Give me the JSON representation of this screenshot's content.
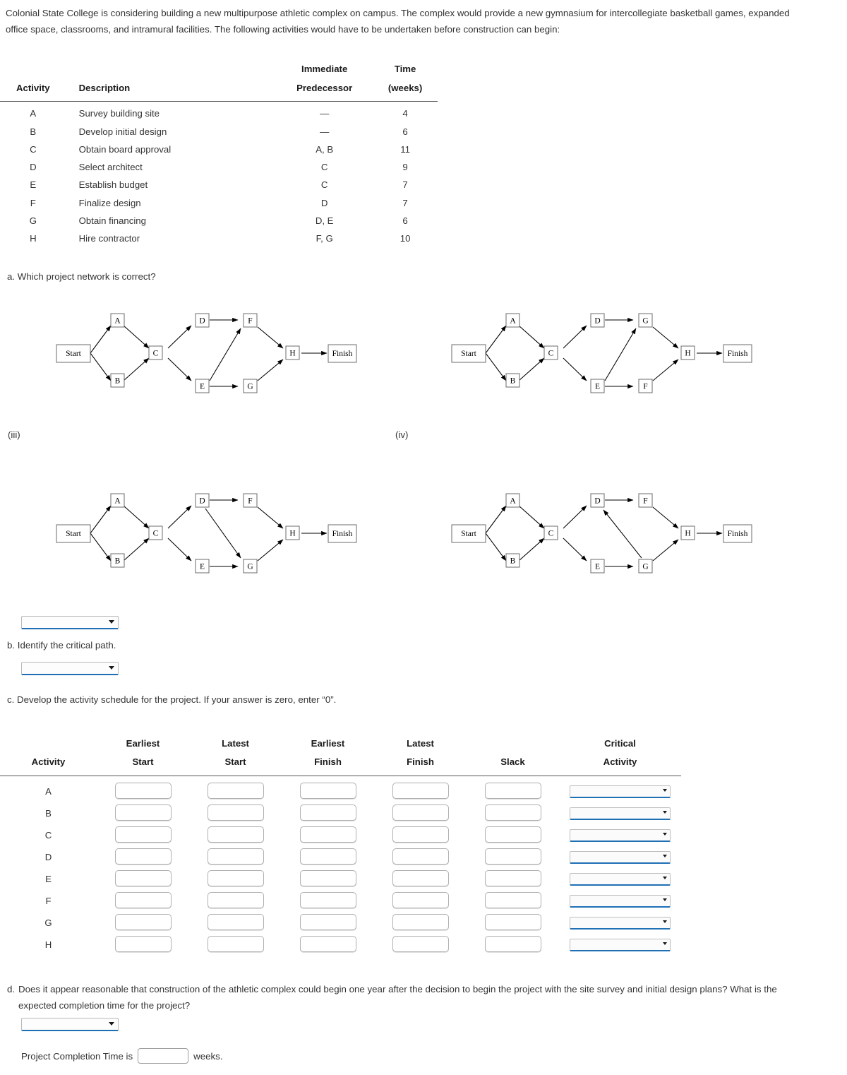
{
  "intro": "Colonial State College is considering building a new multipurpose athletic complex on campus. The complex would provide a new gymnasium for intercollegiate basketball games, expanded office space, classrooms, and intramural facilities. The following activities would have to be undertaken before construction can begin:",
  "activity_table": {
    "headers": {
      "activity": "Activity",
      "description": "Description",
      "predecessor_line1": "Immediate",
      "predecessor_line2": "Predecessor",
      "time_line1": "Time",
      "time_line2": "(weeks)"
    },
    "rows": [
      {
        "activity": "A",
        "description": "Survey building site",
        "predecessor": "—",
        "time": "4"
      },
      {
        "activity": "B",
        "description": "Develop initial design",
        "predecessor": "—",
        "time": "6"
      },
      {
        "activity": "C",
        "description": "Obtain board approval",
        "predecessor": "A, B",
        "time": "11"
      },
      {
        "activity": "D",
        "description": "Select architect",
        "predecessor": "C",
        "time": "9"
      },
      {
        "activity": "E",
        "description": "Establish budget",
        "predecessor": "C",
        "time": "7"
      },
      {
        "activity": "F",
        "description": "Finalize design",
        "predecessor": "D",
        "time": "7"
      },
      {
        "activity": "G",
        "description": "Obtain financing",
        "predecessor": "D, E",
        "time": "6"
      },
      {
        "activity": "H",
        "description": "Hire contractor",
        "predecessor": "F, G",
        "time": "10"
      }
    ]
  },
  "questions": {
    "a": "a. Which project network is correct?",
    "b": "b. Identify the critical path.",
    "c": "c. Develop the activity schedule for the project. If your answer is zero, enter “0”.",
    "d_label": "d.",
    "d_text": "Does it appear reasonable that construction of the athletic complex could begin one year after the decision to begin the project with the site survey and initial design plans? What is the expected completion time for the project?"
  },
  "network_labels": {
    "iii": "(iii)",
    "iv": "(iv)"
  },
  "networks": [
    {
      "id": "i",
      "nodes": [
        "Start",
        "A",
        "B",
        "C",
        "D",
        "E",
        "F",
        "G",
        "H",
        "Finish"
      ],
      "edges": [
        "Start->A",
        "Start->B",
        "A->C",
        "B->C",
        "C->D",
        "C->E",
        "D->F",
        "E->F",
        "E->G",
        "F->H",
        "G->H",
        "H->Finish"
      ],
      "upper_mid": "D",
      "upper_right": "F",
      "lower_mid": "E",
      "lower_right": "G"
    },
    {
      "id": "ii",
      "nodes": [
        "Start",
        "A",
        "B",
        "C",
        "D",
        "E",
        "F",
        "G",
        "H",
        "Finish"
      ],
      "edges": [
        "Start->A",
        "Start->B",
        "A->C",
        "B->C",
        "C->D",
        "C->E",
        "D->G",
        "E->G",
        "E->F",
        "G->H",
        "F->H",
        "H->Finish"
      ],
      "upper_mid": "D",
      "upper_right": "G",
      "lower_mid": "E",
      "lower_right": "F"
    },
    {
      "id": "iii",
      "nodes": [
        "Start",
        "A",
        "B",
        "C",
        "D",
        "E",
        "F",
        "G",
        "H",
        "Finish"
      ],
      "edges": [
        "Start->A",
        "Start->B",
        "A->C",
        "B->C",
        "C->D",
        "C->E",
        "D->F",
        "D->G",
        "E->G",
        "F->H",
        "G->H",
        "H->Finish"
      ],
      "upper_mid": "D",
      "upper_right": "F",
      "lower_mid": "E",
      "lower_right": "G"
    },
    {
      "id": "iv",
      "nodes": [
        "Start",
        "A",
        "B",
        "C",
        "D",
        "E",
        "F",
        "G",
        "H",
        "Finish"
      ],
      "edges": [
        "Start->A",
        "Start->B",
        "A->C",
        "B->C",
        "C->D",
        "C->E",
        "D->F",
        "G->D",
        "E->G",
        "F->H",
        "G->H",
        "H->Finish"
      ],
      "upper_mid": "D",
      "upper_right": "F",
      "lower_mid": "E",
      "lower_right": "G"
    }
  ],
  "node_labels": {
    "start": "Start",
    "finish": "Finish",
    "a": "A",
    "b": "B",
    "c": "C",
    "d": "D",
    "e": "E",
    "f": "F",
    "g": "G",
    "h": "H"
  },
  "schedule_table": {
    "headers": {
      "activity": "Activity",
      "es_line1": "Earliest",
      "es_line2": "Start",
      "ls_line1": "Latest",
      "ls_line2": "Start",
      "ef_line1": "Earliest",
      "ef_line2": "Finish",
      "lf_line1": "Latest",
      "lf_line2": "Finish",
      "slack": "Slack",
      "ca_line1": "Critical",
      "ca_line2": "Activity"
    },
    "rows": [
      {
        "activity": "A",
        "earliest_start": "",
        "latest_start": "",
        "earliest_finish": "",
        "latest_finish": "",
        "slack": "",
        "critical_activity": ""
      },
      {
        "activity": "B",
        "earliest_start": "",
        "latest_start": "",
        "earliest_finish": "",
        "latest_finish": "",
        "slack": "",
        "critical_activity": ""
      },
      {
        "activity": "C",
        "earliest_start": "",
        "latest_start": "",
        "earliest_finish": "",
        "latest_finish": "",
        "slack": "",
        "critical_activity": ""
      },
      {
        "activity": "D",
        "earliest_start": "",
        "latest_start": "",
        "earliest_finish": "",
        "latest_finish": "",
        "slack": "",
        "critical_activity": ""
      },
      {
        "activity": "E",
        "earliest_start": "",
        "latest_start": "",
        "earliest_finish": "",
        "latest_finish": "",
        "slack": "",
        "critical_activity": ""
      },
      {
        "activity": "F",
        "earliest_start": "",
        "latest_start": "",
        "earliest_finish": "",
        "latest_finish": "",
        "slack": "",
        "critical_activity": ""
      },
      {
        "activity": "G",
        "earliest_start": "",
        "latest_start": "",
        "earliest_finish": "",
        "latest_finish": "",
        "slack": "",
        "critical_activity": ""
      },
      {
        "activity": "H",
        "earliest_start": "",
        "latest_start": "",
        "earliest_finish": "",
        "latest_finish": "",
        "slack": "",
        "critical_activity": ""
      }
    ]
  },
  "completion": {
    "prefix": "Project Completion Time is",
    "value": "",
    "suffix": "weeks."
  },
  "dropdowns": {
    "a_value": "",
    "b_value": "",
    "d_value": ""
  },
  "colors": {
    "accent_underline": "#1f6fb5",
    "text": "#333333",
    "rule": "#555555"
  }
}
